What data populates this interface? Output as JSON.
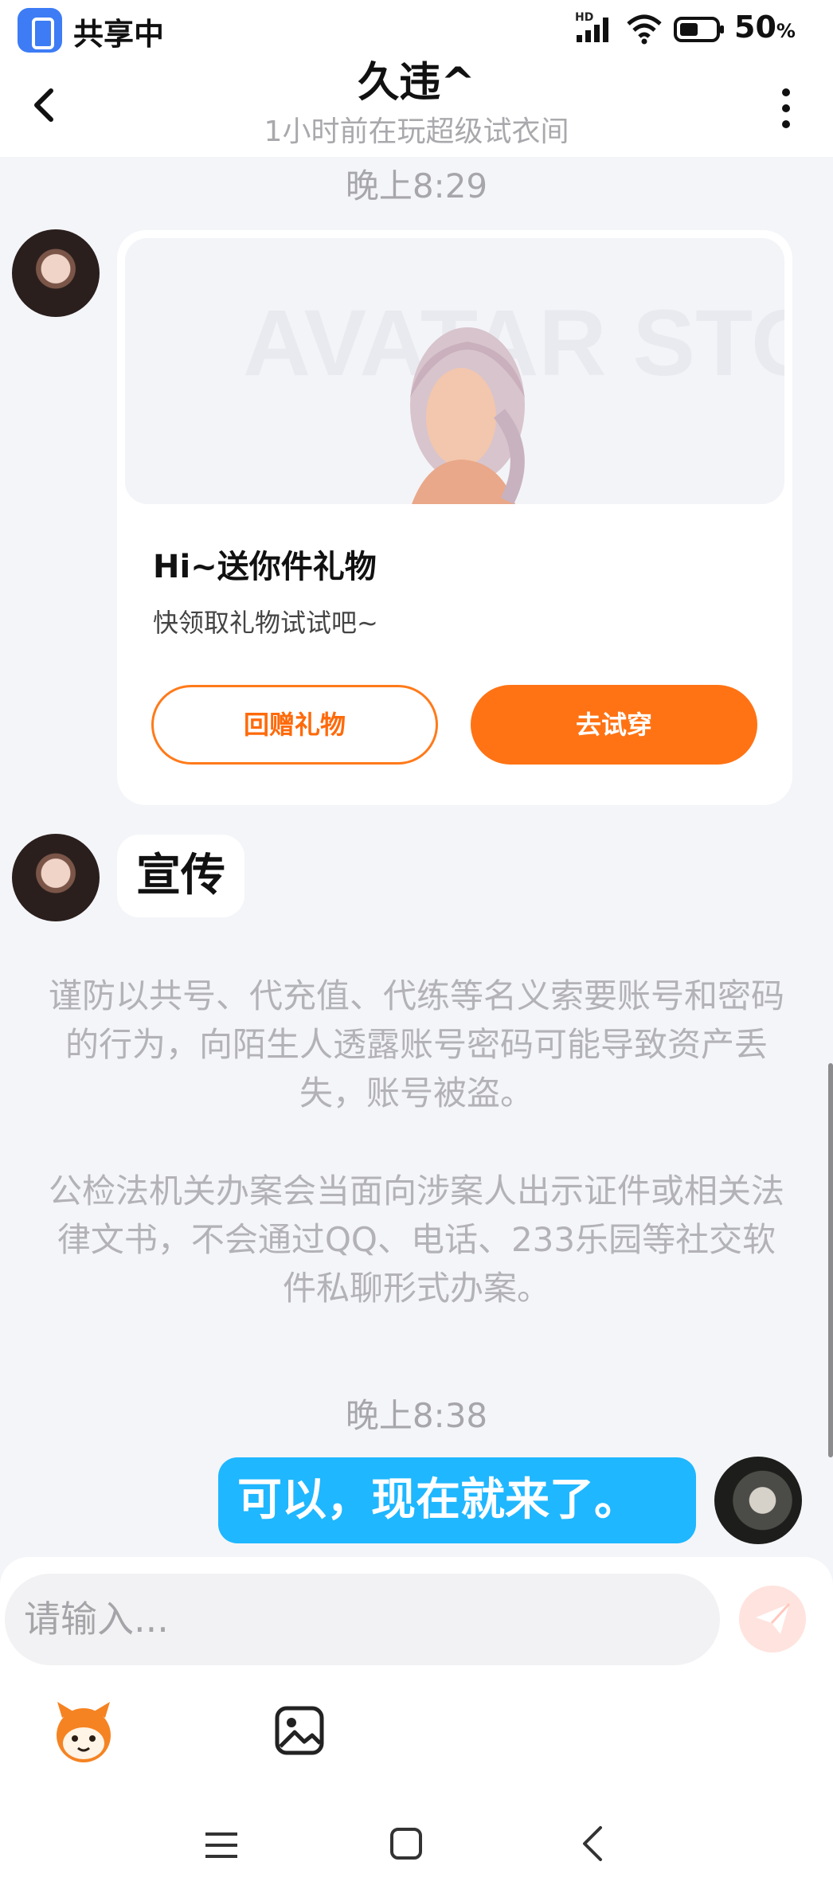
{
  "status_bar": {
    "share_label": "共享中",
    "network": "HD",
    "battery": "50",
    "battery_unit": "%"
  },
  "header": {
    "title": "久违^",
    "subtitle": "1小时前在玩超级试衣间",
    "icons": [
      "chevron-left-icon",
      "more-vertical-icon"
    ]
  },
  "messages": {
    "timestamp_1": "晚上8:29",
    "gift_card": {
      "title": "Hi~送你件礼物",
      "subtitle": "快领取礼物试试吧~",
      "return_gift_label": "回赠礼物",
      "try_on_label": "去试穿",
      "banner_watermark": "AVATAR STORE"
    },
    "text_in": "宣传",
    "notice_1": "谨防以共号、代充值、代练等名义索要账号和密码的行为，向陌生人透露账号密码可能导致资产丢失，账号被盗。",
    "notice_2": "公检法机关办案会当面向涉案人出示证件或相关法律文书，不会通过QQ、电话、233乐园等社交软件私聊形式办案。",
    "timestamp_2": "晚上8:38",
    "text_out": "可以，现在就来了。"
  },
  "composer": {
    "placeholder": "请输入...",
    "icons": [
      "send-icon",
      "emoji-icon",
      "image-icon"
    ]
  },
  "colors": {
    "accent_orange": "#ff7314",
    "outgoing_bubble": "#1fb7ff",
    "background": "#f4f5f9"
  }
}
